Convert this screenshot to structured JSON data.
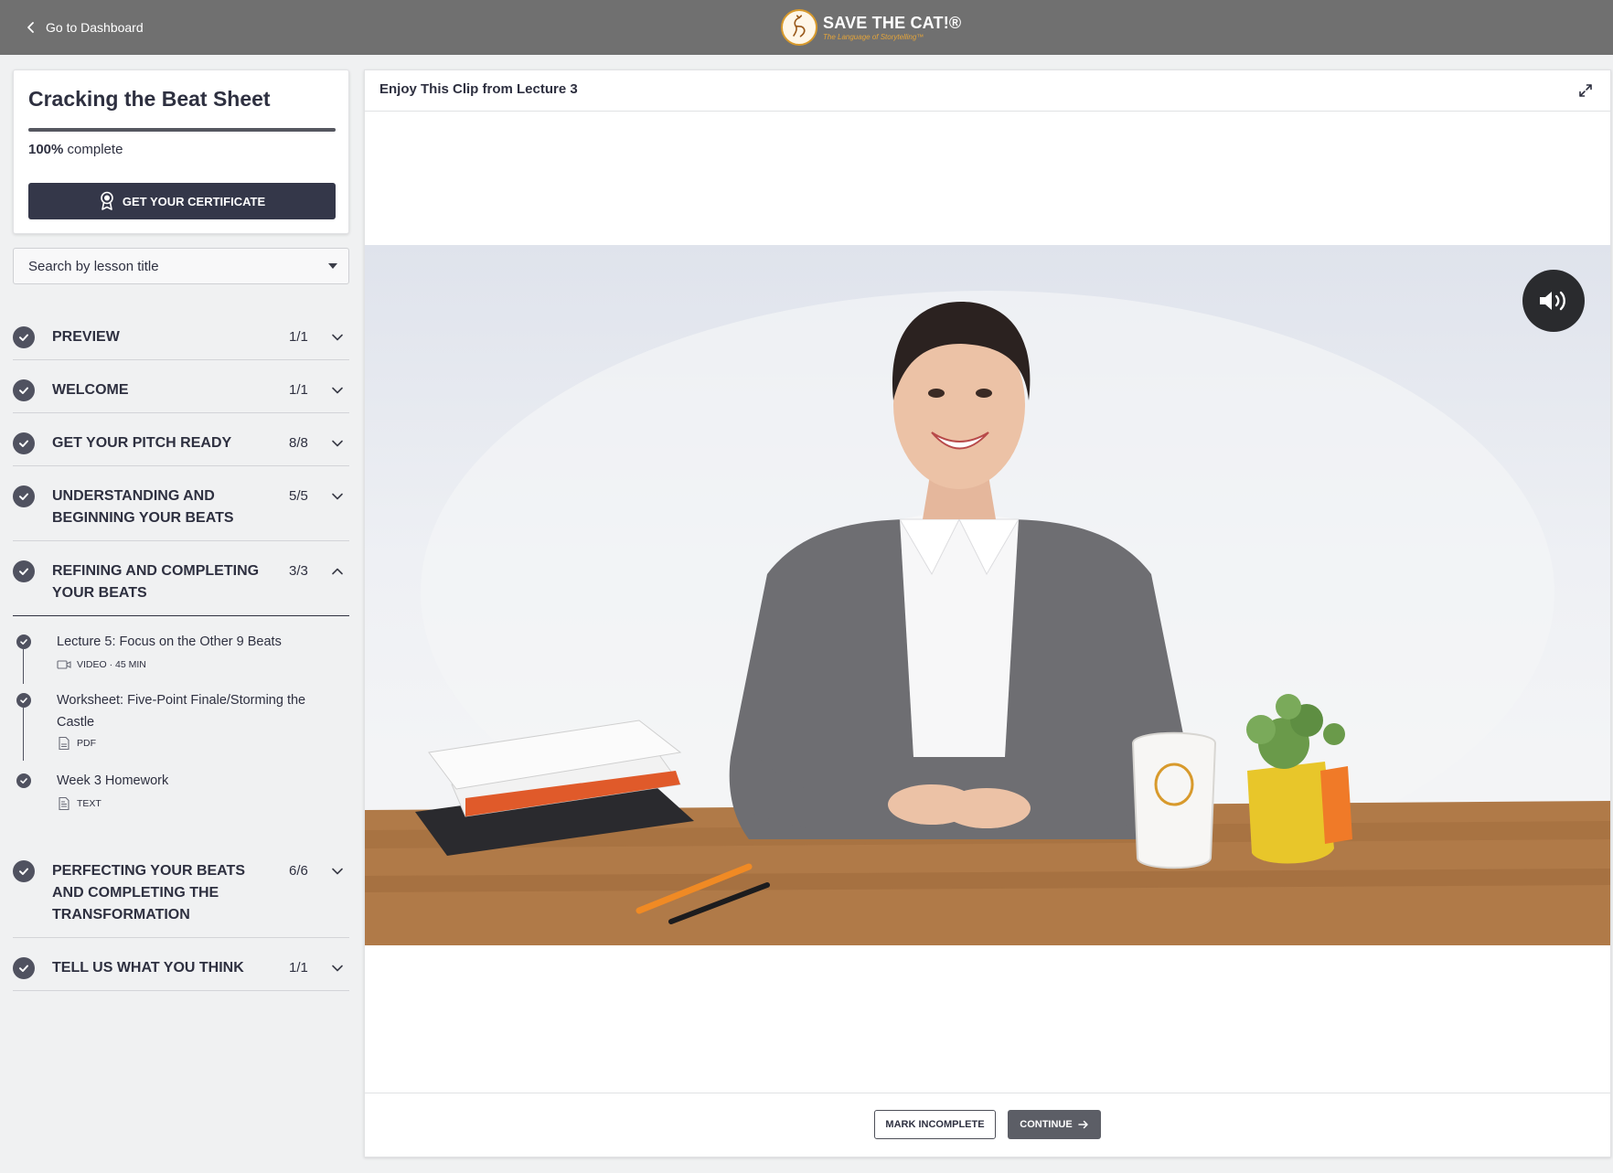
{
  "topbar": {
    "back_label": "Go to Dashboard",
    "logo_title": "SAVE THE CAT!®",
    "logo_subtitle": "The Language of Storytelling™"
  },
  "course": {
    "title": "Cracking the Beat Sheet",
    "progress_percent": 100,
    "progress_value_label": "100%",
    "progress_suffix": " complete",
    "certificate_label": "GET YOUR CERTIFICATE"
  },
  "search": {
    "placeholder": "Search by lesson title"
  },
  "sections": [
    {
      "title": "PREVIEW",
      "count": "1/1",
      "expanded": false
    },
    {
      "title": "WELCOME",
      "count": "1/1",
      "expanded": false
    },
    {
      "title": "GET YOUR PITCH READY",
      "count": "8/8",
      "expanded": false
    },
    {
      "title": "UNDERSTANDING AND BEGINNING YOUR BEATS",
      "count": "5/5",
      "expanded": false
    },
    {
      "title": "REFINING AND COMPLETING YOUR BEATS",
      "count": "3/3",
      "expanded": true,
      "lessons": [
        {
          "title": "Lecture 5: Focus on the Other 9 Beats",
          "meta": "VIDEO · 45 MIN",
          "icon": "video-icon"
        },
        {
          "title": "Worksheet: Five-Point Finale/Storming the Castle",
          "meta": "PDF",
          "icon": "pdf-icon"
        },
        {
          "title": "Week 3 Homework",
          "meta": "TEXT",
          "icon": "text-doc-icon"
        }
      ]
    },
    {
      "title": "PERFECTING YOUR BEATS AND COMPLETING THE TRANSFORMATION",
      "count": "6/6",
      "expanded": false
    },
    {
      "title": "TELL US WHAT YOU THINK",
      "count": "1/1",
      "expanded": false
    }
  ],
  "main": {
    "title": "Enjoy This Clip from Lecture 3",
    "mark_incomplete_label": "MARK INCOMPLETE",
    "continue_label": "CONTINUE"
  },
  "colors": {
    "topbar": "#707070",
    "primary_button": "#343749",
    "check": "#505260",
    "logo_accent": "#d89a2c"
  }
}
